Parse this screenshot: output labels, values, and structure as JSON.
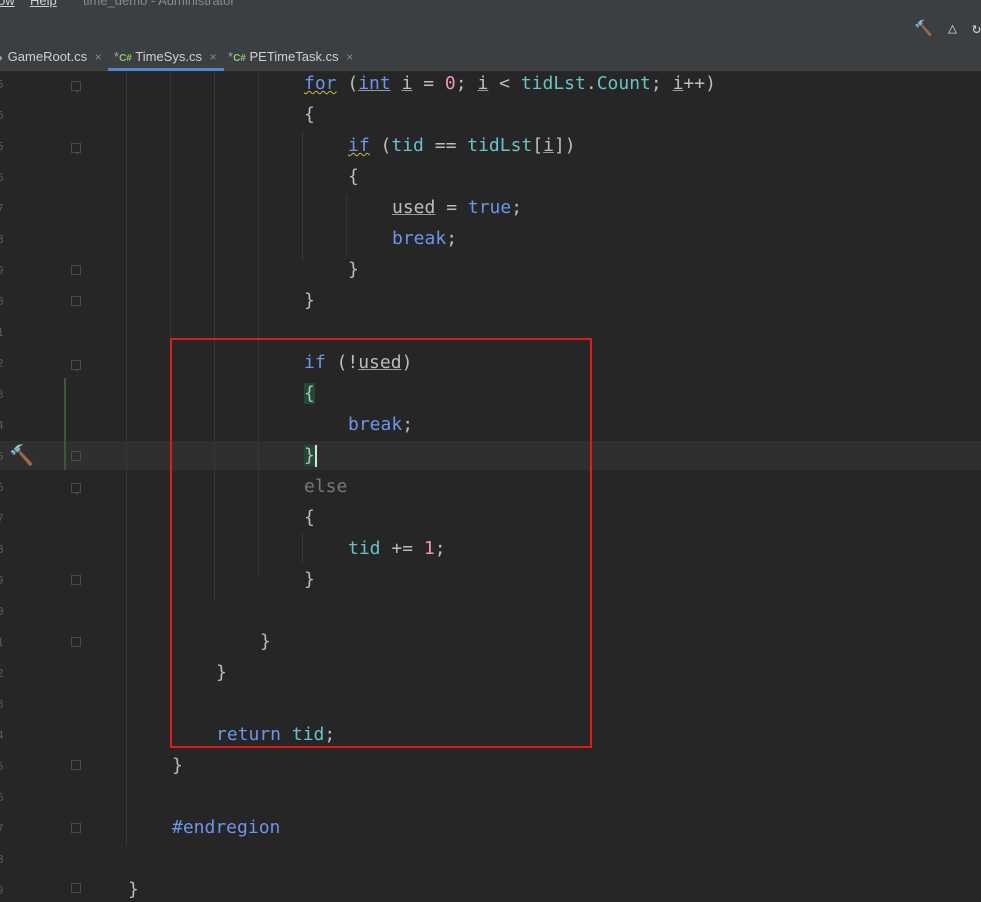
{
  "menubar": {
    "items": [
      "ow",
      "Help"
    ]
  },
  "window_title": "time_demo - Administrator",
  "tabs": [
    {
      "label": "GameRoot.cs",
      "modified": false,
      "active": false
    },
    {
      "label": "TimeSys.cs",
      "modified": true,
      "active": true,
      "lang": "C#"
    },
    {
      "label": "PETimeTask.cs",
      "modified": true,
      "active": false,
      "lang": "C#"
    }
  ],
  "tab_close": "×",
  "tab_mod_marker": "*",
  "code": {
    "l1": {
      "for": "for",
      "open": " (",
      "int": "int",
      "sp": " ",
      "i": "i",
      "eq": " = ",
      "zero": "0",
      "semi": "; ",
      "i2": "i",
      "lt": " < ",
      "lst": "tidLst",
      "dot": ".",
      "count": "Count",
      "semi2": "; ",
      "i3": "i",
      "inc": "++)"
    },
    "l2": "{",
    "l3": {
      "if": "if",
      "open": " (",
      "tid": "tid",
      "eq": " == ",
      "lst": "tidLst",
      "lb": "[",
      "i": "i",
      "rb": "])"
    },
    "l4": "{",
    "l5": {
      "used": "used",
      "eq": " = ",
      "true": "true",
      "semi": ";"
    },
    "l6": {
      "break": "break",
      "semi": ";"
    },
    "l7": "}",
    "l8": "}",
    "l9": {
      "if": "if",
      "open": " (!",
      "used": "used",
      "close": ")"
    },
    "l10": "{",
    "l11": {
      "break": "break",
      "semi": ";"
    },
    "l12": "}",
    "l13": "else",
    "l14": "{",
    "l15": {
      "tid": "tid",
      "op": " += ",
      "one": "1",
      "semi": ";"
    },
    "l16": "}",
    "l17": "}",
    "l18": "}",
    "l19": {
      "return": "return",
      "sp": " ",
      "tid": "tid",
      "semi": ";"
    },
    "l20": "}",
    "l21": "#endregion",
    "l22": "}"
  },
  "line_number_fragments": [
    "5",
    "6",
    "5",
    "6",
    "7",
    "8",
    "9",
    "0",
    "1",
    "2",
    "3",
    "4",
    "5",
    "6",
    "7",
    "8",
    "9",
    "0",
    "1",
    "2",
    "3",
    "4",
    "5",
    "6",
    "7",
    "8",
    "9"
  ],
  "icons": {
    "gutter": "hammer-icon",
    "toolbar_build": "hammer-icon",
    "toolbar_unity": "unity-icon",
    "toolbar_refresh": "refresh-icon"
  },
  "colors": {
    "highlight_box": "#e01b1b",
    "keyword": "#6c95eb",
    "identifier": "#66c3cc",
    "number": "#ed94c0",
    "background": "#262626"
  }
}
